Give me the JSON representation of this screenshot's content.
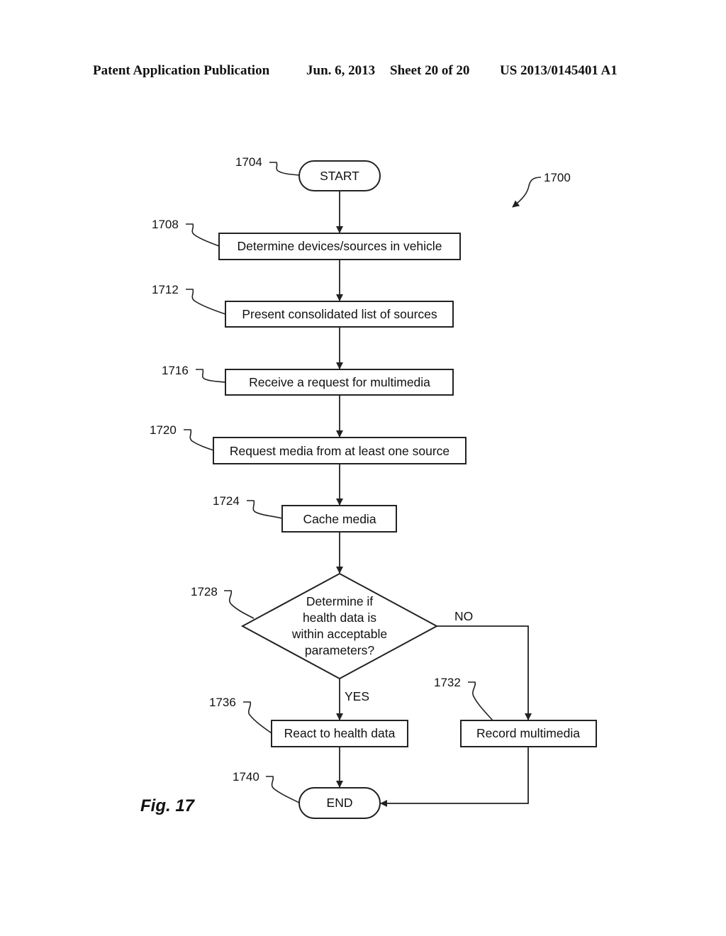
{
  "header": {
    "publication": "Patent Application Publication",
    "date": "Jun. 6, 2013",
    "sheet": "Sheet 20 of 20",
    "number": "US 2013/0145401 A1"
  },
  "figure": {
    "label": "Fig. 17",
    "ref": "1700"
  },
  "nodes": {
    "start": {
      "ref": "1704",
      "text": "START"
    },
    "determine_devices": {
      "ref": "1708",
      "text": "Determine devices/sources in vehicle"
    },
    "present_list": {
      "ref": "1712",
      "text": "Present consolidated list of sources"
    },
    "receive_request": {
      "ref": "1716",
      "text": "Receive a request for multimedia"
    },
    "request_media": {
      "ref": "1720",
      "text": "Request media from at least one source"
    },
    "cache_media": {
      "ref": "1724",
      "text": "Cache media"
    },
    "decision": {
      "ref": "1728",
      "lines": [
        "Determine if",
        "health data is",
        "within acceptable",
        "parameters?"
      ]
    },
    "record_multimedia": {
      "ref": "1732",
      "text": "Record multimedia"
    },
    "react": {
      "ref": "1736",
      "text": "React to health data"
    },
    "end": {
      "ref": "1740",
      "text": "END"
    }
  },
  "edges": {
    "no_label": "NO",
    "yes_label": "YES"
  }
}
